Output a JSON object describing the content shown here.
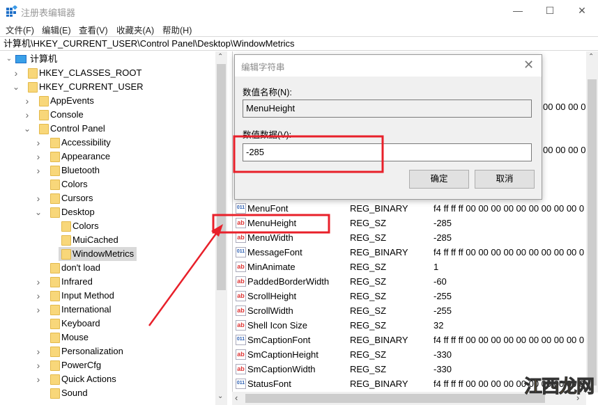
{
  "window": {
    "title": "注册表编辑器",
    "minimize": "—",
    "maximize": "☐",
    "close": "✕"
  },
  "menu": [
    "文件(F)",
    "编辑(E)",
    "查看(V)",
    "收藏夹(A)",
    "帮助(H)"
  ],
  "address": "计算机\\HKEY_CURRENT_USER\\Control Panel\\Desktop\\WindowMetrics",
  "tree": [
    {
      "label": "计算机",
      "level": 0,
      "expanded": true,
      "root": true
    },
    {
      "label": "HKEY_CLASSES_ROOT",
      "level": 1,
      "expander": "collapsed"
    },
    {
      "label": "HKEY_CURRENT_USER",
      "level": 1,
      "expander": "expanded"
    },
    {
      "label": "AppEvents",
      "level": 2,
      "expander": "collapsed"
    },
    {
      "label": "Console",
      "level": 2,
      "expander": "collapsed"
    },
    {
      "label": "Control Panel",
      "level": 2,
      "expander": "expanded"
    },
    {
      "label": "Accessibility",
      "level": 3,
      "expander": "collapsed"
    },
    {
      "label": "Appearance",
      "level": 3,
      "expander": "collapsed"
    },
    {
      "label": "Bluetooth",
      "level": 3,
      "expander": "collapsed"
    },
    {
      "label": "Colors",
      "level": 3,
      "expander": "none"
    },
    {
      "label": "Cursors",
      "level": 3,
      "expander": "collapsed"
    },
    {
      "label": "Desktop",
      "level": 3,
      "expander": "expanded"
    },
    {
      "label": "Colors",
      "level": 4,
      "expander": "none"
    },
    {
      "label": "MuiCached",
      "level": 4,
      "expander": "none"
    },
    {
      "label": "WindowMetrics",
      "level": 4,
      "expander": "none",
      "selected": true
    },
    {
      "label": "don't load",
      "level": 3,
      "expander": "none"
    },
    {
      "label": "Infrared",
      "level": 3,
      "expander": "collapsed"
    },
    {
      "label": "Input Method",
      "level": 3,
      "expander": "collapsed"
    },
    {
      "label": "International",
      "level": 3,
      "expander": "collapsed"
    },
    {
      "label": "Keyboard",
      "level": 3,
      "expander": "none"
    },
    {
      "label": "Mouse",
      "level": 3,
      "expander": "none"
    },
    {
      "label": "Personalization",
      "level": 3,
      "expander": "collapsed"
    },
    {
      "label": "PowerCfg",
      "level": 3,
      "expander": "collapsed"
    },
    {
      "label": "Quick Actions",
      "level": 3,
      "expander": "collapsed"
    },
    {
      "label": "Sound",
      "level": 3,
      "expander": "none"
    }
  ],
  "values_partial_behind_dialog": [
    "00 00 00 0",
    "00 00 00 0"
  ],
  "values": [
    {
      "name": "MenuFont",
      "type": "REG_BINARY",
      "data": "f4 ff ff ff 00 00 00 00 00 00 00 00 00 0",
      "icon": "binary"
    },
    {
      "name": "MenuHeight",
      "type": "REG_SZ",
      "data": "-285",
      "icon": "string"
    },
    {
      "name": "MenuWidth",
      "type": "REG_SZ",
      "data": "-285",
      "icon": "string"
    },
    {
      "name": "MessageFont",
      "type": "REG_BINARY",
      "data": "f4 ff ff ff 00 00 00 00 00 00 00 00 00 0",
      "icon": "binary"
    },
    {
      "name": "MinAnimate",
      "type": "REG_SZ",
      "data": "1",
      "icon": "string"
    },
    {
      "name": "PaddedBorderWidth",
      "type": "REG_SZ",
      "data": "-60",
      "icon": "string"
    },
    {
      "name": "ScrollHeight",
      "type": "REG_SZ",
      "data": "-255",
      "icon": "string"
    },
    {
      "name": "ScrollWidth",
      "type": "REG_SZ",
      "data": "-255",
      "icon": "string"
    },
    {
      "name": "Shell Icon Size",
      "type": "REG_SZ",
      "data": "32",
      "icon": "string"
    },
    {
      "name": "SmCaptionFont",
      "type": "REG_BINARY",
      "data": "f4 ff ff ff 00 00 00 00 00 00 00 00 00 0",
      "icon": "binary"
    },
    {
      "name": "SmCaptionHeight",
      "type": "REG_SZ",
      "data": "-330",
      "icon": "string"
    },
    {
      "name": "SmCaptionWidth",
      "type": "REG_SZ",
      "data": "-330",
      "icon": "string"
    },
    {
      "name": "StatusFont",
      "type": "REG_BINARY",
      "data": "f4 ff ff ff 00 00 00 00 00 00 00 00 00 0",
      "icon": "binary"
    }
  ],
  "dialog": {
    "title": "编辑字符串",
    "name_label": "数值名称(N):",
    "name_value": "MenuHeight",
    "data_label": "数值数据(V):",
    "data_value": "-285",
    "ok": "确定",
    "cancel": "取消"
  },
  "annotation_color": "#e8202a",
  "watermark": "江西龙网"
}
